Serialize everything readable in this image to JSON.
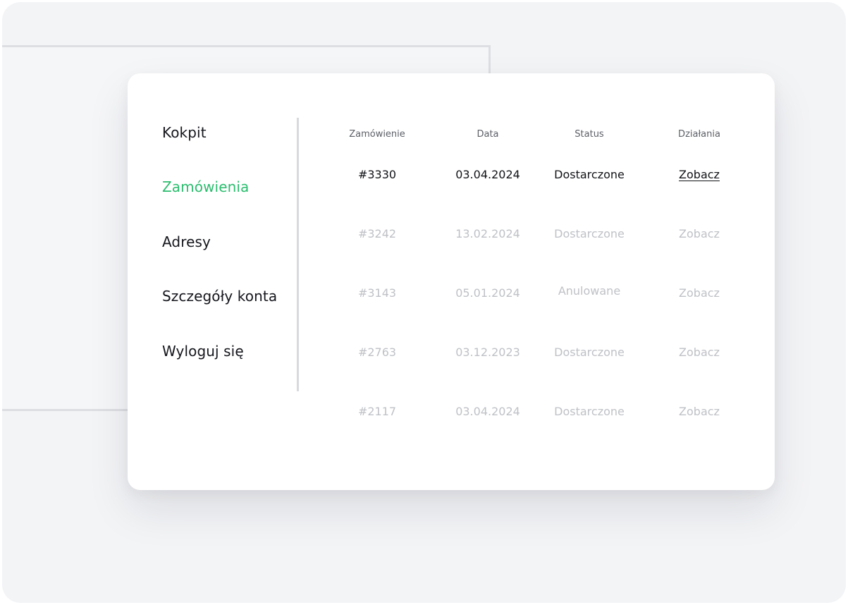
{
  "nav": {
    "items": [
      {
        "label": "Kokpit",
        "active": false
      },
      {
        "label": "Zamówienia",
        "active": true
      },
      {
        "label": "Adresy",
        "active": false
      },
      {
        "label": "Szczegóły konta",
        "active": false
      },
      {
        "label": "Wyloguj się",
        "active": false
      }
    ]
  },
  "table": {
    "headers": {
      "order": "Zamówienie",
      "date": "Data",
      "status": "Status",
      "actions": "Działania"
    },
    "rows": [
      {
        "order": "#3330",
        "date": "03.04.2024",
        "status": "Dostarczone",
        "action": "Zobacz",
        "highlighted": true
      },
      {
        "order": "#3242",
        "date": "13.02.2024",
        "status": "Dostarczone",
        "action": "Zobacz",
        "highlighted": false
      },
      {
        "order": "#3143",
        "date": "05.01.2024",
        "status": "Anulowane",
        "action": "Zobacz",
        "highlighted": false
      },
      {
        "order": "#2763",
        "date": "03.12.2023",
        "status": "Dostarczone",
        "action": "Zobacz",
        "highlighted": false
      },
      {
        "order": "#2117",
        "date": "03.04.2024",
        "status": "Dostarczone",
        "action": "Zobacz",
        "highlighted": false
      }
    ]
  },
  "colors": {
    "accent": "#2bbd6e",
    "text_primary": "#111216",
    "text_muted": "#bfc1c6"
  }
}
